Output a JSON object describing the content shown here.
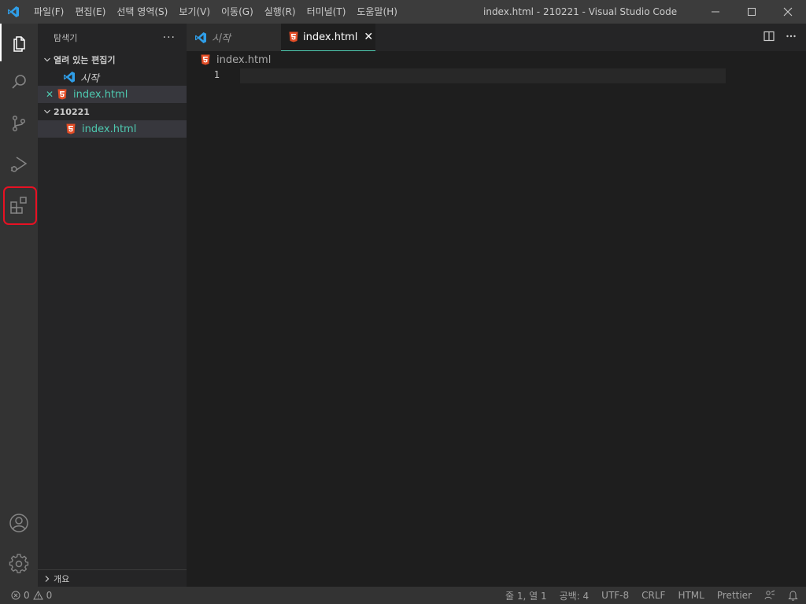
{
  "titlebar": {
    "menu": [
      "파일(F)",
      "편집(E)",
      "선택 영역(S)",
      "보기(V)",
      "이동(G)",
      "실행(R)",
      "터미널(T)",
      "도움말(H)"
    ],
    "window_title": "index.html - 210221 - Visual Studio Code",
    "controls": [
      "minimize-icon",
      "maximize-icon",
      "close-icon"
    ]
  },
  "activitybar": {
    "items": [
      "explorer-icon",
      "search-icon",
      "source-control-icon",
      "run-debug-icon",
      "extensions-icon"
    ],
    "bottom": [
      "account-icon",
      "settings-gear-icon"
    ],
    "highlighted": "extensions-icon",
    "highlight_color": "#e81123"
  },
  "sidebar": {
    "title": "탐색기",
    "more": "···",
    "open_editors": {
      "label": "열려 있는 편집기",
      "items": [
        {
          "name": "시작",
          "icon": "vscode-icon"
        },
        {
          "name": "index.html",
          "icon": "html5-icon",
          "close": "✕"
        }
      ]
    },
    "folder": {
      "label": "210221",
      "items": [
        {
          "name": "index.html",
          "icon": "html5-icon"
        }
      ]
    },
    "outline": {
      "label": "개요"
    }
  },
  "editor": {
    "tabs": [
      {
        "label": "시작",
        "icon": "vscode-icon",
        "active": false
      },
      {
        "label": "index.html",
        "icon": "html5-icon",
        "active": true,
        "close": "✕"
      }
    ],
    "breadcrumb": "index.html",
    "lines": [
      {
        "number": "1",
        "text": ""
      }
    ]
  },
  "statusbar": {
    "errors": "0",
    "warnings": "0",
    "position": "줄 1, 열 1",
    "spaces": "공백: 4",
    "encoding": "UTF-8",
    "eol": "CRLF",
    "language": "HTML",
    "formatter": "Prettier"
  },
  "colors": {
    "accent_teal": "#4ec9b0",
    "html_orange": "#e44d26",
    "vscode_blue": "#0e7ad3"
  }
}
